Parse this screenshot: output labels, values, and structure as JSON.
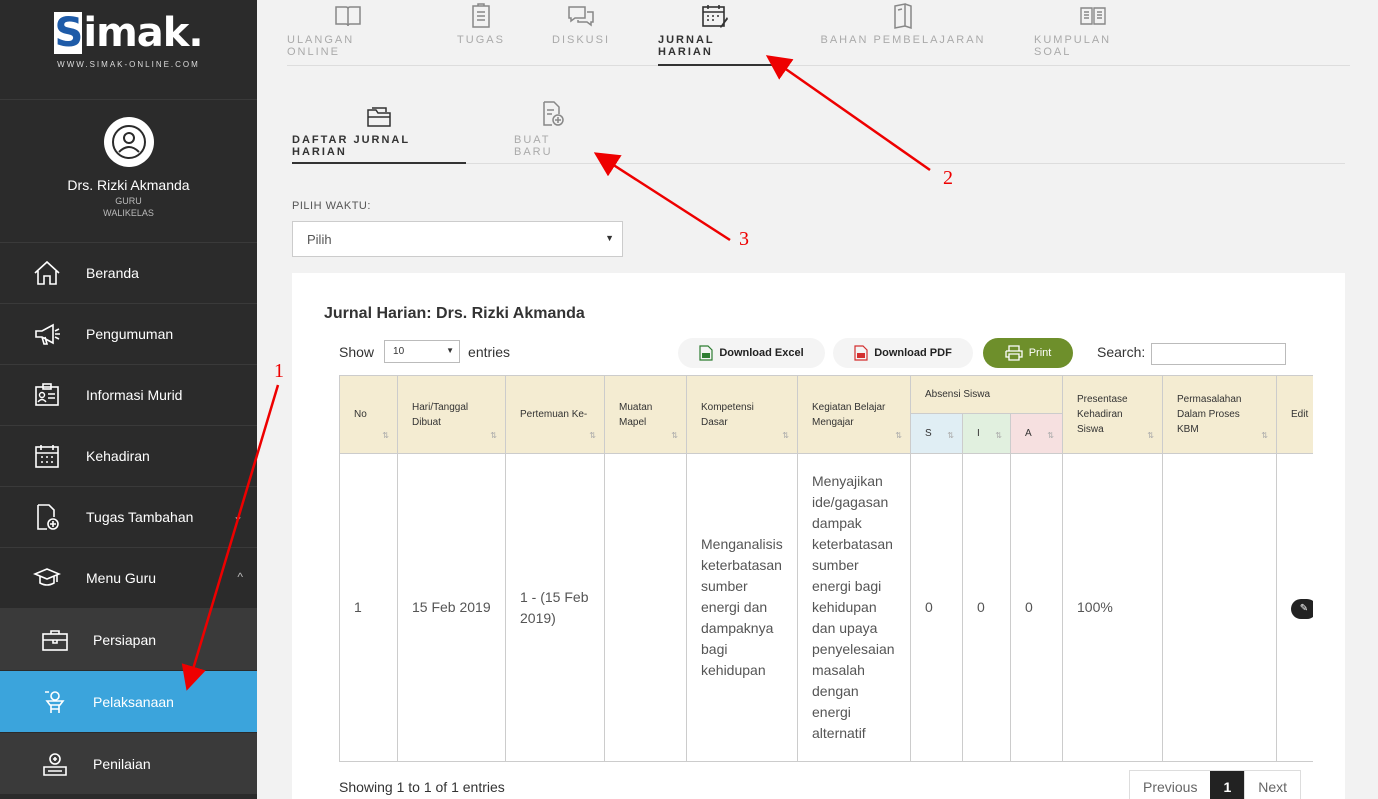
{
  "brand": {
    "name": "imak.",
    "logo_letter": "S",
    "tagline": "WWW.SIMAK-ONLINE.COM"
  },
  "profile": {
    "name": "Drs. Rizki Akmanda",
    "role": "GURU",
    "subrole": "WALIKELAS"
  },
  "sidebar": {
    "items": [
      {
        "label": "Beranda",
        "icon": "home-icon"
      },
      {
        "label": "Pengumuman",
        "icon": "megaphone-icon"
      },
      {
        "label": "Informasi Murid",
        "icon": "id-card-icon"
      },
      {
        "label": "Kehadiran",
        "icon": "calendar-icon"
      },
      {
        "label": "Tugas Tambahan",
        "icon": "document-add-icon",
        "chevron": "⌄"
      },
      {
        "label": "Menu Guru",
        "icon": "graduation-cap-icon",
        "chevron": "^"
      }
    ],
    "sub_items": [
      {
        "label": "Persiapan",
        "icon": "briefcase-icon"
      },
      {
        "label": "Pelaksanaan",
        "icon": "teacher-icon"
      },
      {
        "label": "Penilaian",
        "icon": "grading-icon"
      }
    ]
  },
  "top_tabs": [
    {
      "label": "ULANGAN ONLINE",
      "icon": "book-icon"
    },
    {
      "label": "TUGAS",
      "icon": "clipboard-icon"
    },
    {
      "label": "DISKUSI",
      "icon": "chat-icon"
    },
    {
      "label": "JURNAL HARIAN",
      "icon": "calendar-edit-icon"
    },
    {
      "label": "BAHAN PEMBELAJARAN",
      "icon": "books-icon"
    },
    {
      "label": "KUMPULAN SOAL",
      "icon": "open-book-icon"
    }
  ],
  "sub_tabs": [
    {
      "label": "DAFTAR JURNAL HARIAN",
      "icon": "folder-icon"
    },
    {
      "label": "BUAT BARU",
      "icon": "file-add-icon"
    }
  ],
  "filter": {
    "label": "PILIH WAKTU:",
    "value": "Pilih"
  },
  "panel": {
    "title": "Jurnal Harian: Drs. Rizki Akmanda",
    "show_label": "Show",
    "entries_value": "10",
    "entries_label": "entries",
    "download_excel": "Download Excel",
    "download_pdf": "Download PDF",
    "print": "Print",
    "search_label": "Search:"
  },
  "table": {
    "headers": {
      "no": "No",
      "date": "Hari/Tanggal Dibuat",
      "meeting": "Pertemuan Ke-",
      "subject": "Muatan Mapel",
      "competency": "Kompetensi Dasar",
      "activity": "Kegiatan Belajar Mengajar",
      "attendance": "Absensi Siswa",
      "s": "S",
      "i": "I",
      "a": "A",
      "percent": "Presentase Kehadiran Siswa",
      "issues": "Permasalahan Dalam Proses KBM",
      "edit": "Edit"
    },
    "rows": [
      {
        "no": "1",
        "date": "15 Feb 2019",
        "meeting": "1 - (15 Feb 2019)",
        "subject": "",
        "competency": "Menganalisis keterbatasan sumber energi dan dampaknya bagi kehidupan",
        "activity": "Menyajikan ide/gagasan dampak keterbatasan sumber energi bagi kehidupan dan upaya penyelesaian masalah dengan energi alternatif",
        "s": "0",
        "i": "0",
        "a": "0",
        "percent": "100%",
        "issues": ""
      }
    ]
  },
  "footer": {
    "showing": "Showing 1 to 1 of 1 entries",
    "previous": "Previous",
    "page": "1",
    "next": "Next"
  },
  "annotations": [
    "1",
    "2",
    "3"
  ],
  "colors": {
    "sidebar_bg": "#2b2b2b",
    "active_blue": "#3ba4dc",
    "print_green": "#6e8f2b",
    "header_bg": "#f4ecd2",
    "arrow_red": "#e00000"
  }
}
